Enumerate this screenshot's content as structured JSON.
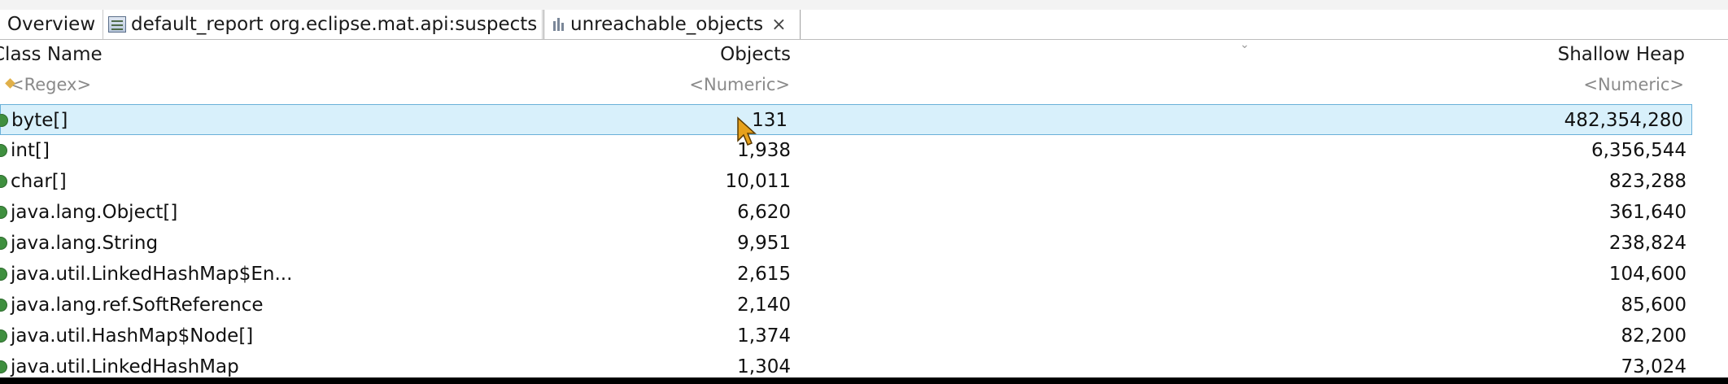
{
  "tabs": [
    {
      "label": "Overview"
    },
    {
      "label": "default_report  org.eclipse.mat.api:suspects"
    },
    {
      "label": "unreachable_objects"
    }
  ],
  "columns": {
    "class_name": "Class Name",
    "objects": "Objects",
    "shallow_heap": "Shallow Heap"
  },
  "filters": {
    "class_name": "<Regex>",
    "objects": "<Numeric>",
    "shallow_heap": "<Numeric>"
  },
  "rows": [
    {
      "class_name": "byte[]",
      "objects": "131",
      "shallow_heap": "482,354,280"
    },
    {
      "class_name": "int[]",
      "objects": "1,938",
      "shallow_heap": "6,356,544"
    },
    {
      "class_name": "char[]",
      "objects": "10,011",
      "shallow_heap": "823,288"
    },
    {
      "class_name": "java.lang.Object[]",
      "objects": "6,620",
      "shallow_heap": "361,640"
    },
    {
      "class_name": "java.lang.String",
      "objects": "9,951",
      "shallow_heap": "238,824"
    },
    {
      "class_name": "java.util.LinkedHashMap$En...",
      "objects": "2,615",
      "shallow_heap": "104,600"
    },
    {
      "class_name": "java.lang.ref.SoftReference",
      "objects": "2,140",
      "shallow_heap": "85,600"
    },
    {
      "class_name": "java.util.HashMap$Node[]",
      "objects": "1,374",
      "shallow_heap": "82,200"
    },
    {
      "class_name": "java.util.LinkedHashMap",
      "objects": "1,304",
      "shallow_heap": "73,024"
    }
  ],
  "icons": {
    "report": "report-icon",
    "bars": "bar-chart-icon",
    "close": "close-icon",
    "class": "class-icon",
    "regex": "regex-filter-icon",
    "sort": "sort-indicator-icon",
    "cursor": "mouse-cursor-icon"
  },
  "colors": {
    "selection_bg": "#d8f0fb",
    "selection_border": "#6ab0d8",
    "class_dot": "#3f8f3f"
  }
}
